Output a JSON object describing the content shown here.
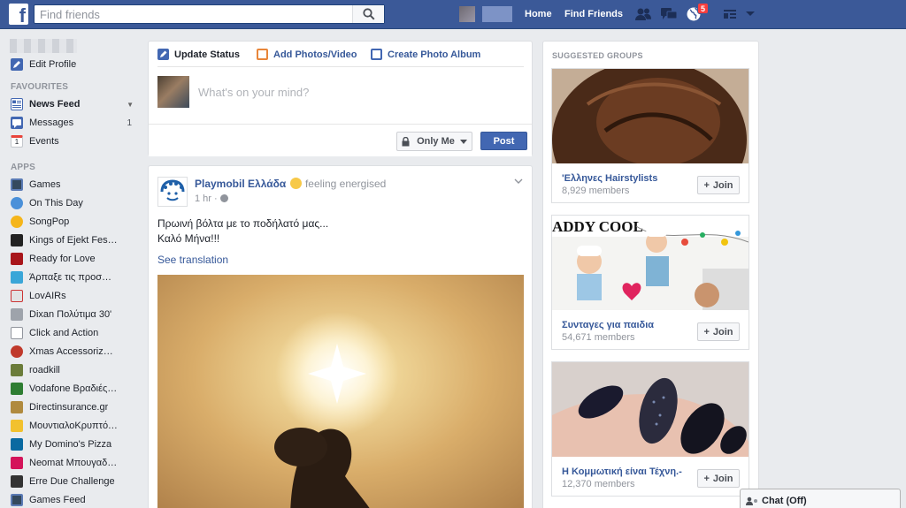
{
  "topbar": {
    "logo_letter": "f",
    "search_placeholder": "Find friends",
    "nav": {
      "home": "Home",
      "find_friends": "Find Friends"
    },
    "notifications_badge": "5",
    "colors": {
      "bar": "#3b5998",
      "badge": "#fa3e3e"
    }
  },
  "left": {
    "edit_profile": "Edit Profile",
    "favourites_title": "FAVOURITES",
    "favourites": [
      {
        "label": "News Feed",
        "icon": "news-feed-icon"
      },
      {
        "label": "Messages",
        "count": "1",
        "icon": "messages-icon"
      },
      {
        "label": "Events",
        "icon": "events-icon",
        "icon_text": "1"
      }
    ],
    "apps_title": "APPS",
    "apps": [
      {
        "label": "Games",
        "icon": "games-icon"
      },
      {
        "label": "On This Day",
        "icon": "on-this-day-icon"
      },
      {
        "label": "SongPop",
        "icon": "songpop-icon"
      },
      {
        "label": "Kings of Ejekt Fest…",
        "icon": "app-icon"
      },
      {
        "label": "Ready for Love",
        "icon": "app-icon"
      },
      {
        "label": "Άρπαξε τις προσφο…",
        "icon": "app-icon"
      },
      {
        "label": "LovAIRs",
        "icon": "app-icon"
      },
      {
        "label": "Dixan Πολύτιμα 30'",
        "icon": "app-icon"
      },
      {
        "label": "Click and Action",
        "icon": "app-icon"
      },
      {
        "label": "Xmas Accessorize …",
        "icon": "app-icon"
      },
      {
        "label": "roadkill",
        "icon": "app-icon"
      },
      {
        "label": "Vodafone Βραδιές …",
        "icon": "app-icon"
      },
      {
        "label": "Directinsurance.gr",
        "icon": "app-icon"
      },
      {
        "label": "ΜουντιαλοΚρυπτόλ…",
        "icon": "app-icon"
      },
      {
        "label": "My Domino's Pizza",
        "icon": "app-icon"
      },
      {
        "label": "Neomat Μπουγαδο…",
        "icon": "app-icon"
      },
      {
        "label": "Erre Due Challenge",
        "icon": "app-icon"
      },
      {
        "label": "Games Feed",
        "icon": "games-feed-icon"
      }
    ]
  },
  "composer": {
    "tabs": [
      "Update Status",
      "Add Photos/Video",
      "Create Photo Album"
    ],
    "placeholder": "What's on your mind?",
    "privacy": "Only Me",
    "post": "Post"
  },
  "story": {
    "page_name": "Playmobil Ελλάδα",
    "feeling": "feeling energised",
    "time": "1 hr ·",
    "text_line1": "Πρωινή βόλτα με το ποδήλατό μας...",
    "text_line2": "Καλό Μήνα!!!",
    "see_translation": "See translation"
  },
  "suggested": {
    "title": "SUGGESTED GROUPS",
    "groups": [
      {
        "name": "'Ελληνες Hairstylists",
        "members": "8,929 members",
        "join": "Join"
      },
      {
        "name": "Συνταγες για παιδια",
        "members": "54,671 members",
        "join": "Join",
        "image_text": "ADDY COOL"
      },
      {
        "name": "Η Κομμωτική είναι Τέχνη.-",
        "members": "12,370 members",
        "join": "Join"
      }
    ]
  },
  "chat": {
    "label": "Chat (Off)"
  }
}
